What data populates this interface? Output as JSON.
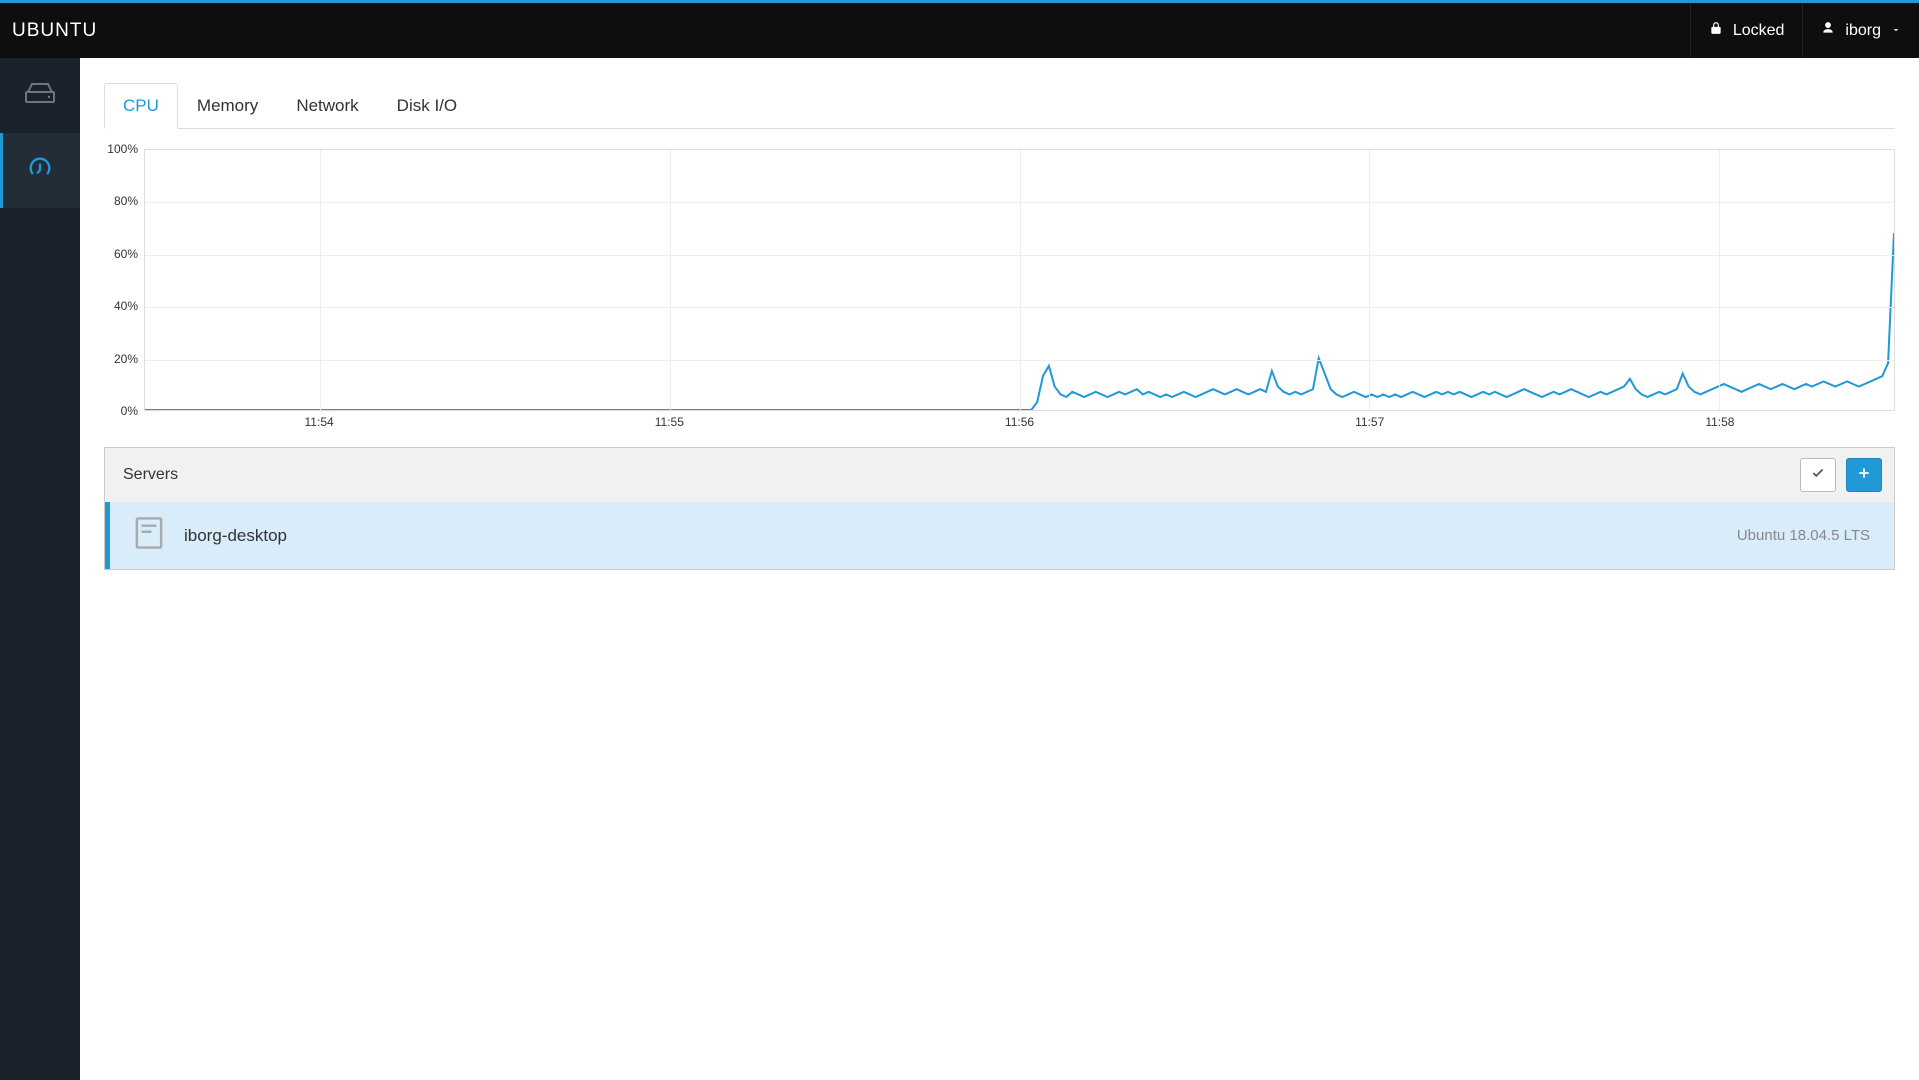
{
  "header": {
    "title": "UBUNTU",
    "lock_label": "Locked",
    "user_label": "iborg"
  },
  "tabs": [
    {
      "label": "CPU"
    },
    {
      "label": "Memory"
    },
    {
      "label": "Network"
    },
    {
      "label": "Disk I/O"
    }
  ],
  "servers": {
    "title": "Servers",
    "items": [
      {
        "name": "iborg-desktop",
        "os": "Ubuntu 18.04.5 LTS"
      }
    ]
  },
  "chart_data": {
    "type": "line",
    "title": "",
    "xlabel": "",
    "ylabel": "",
    "ylim": [
      0,
      100
    ],
    "y_ticks": [
      0,
      20,
      40,
      60,
      80,
      100
    ],
    "x_ticks": [
      "11:54",
      "11:55",
      "11:56",
      "11:57",
      "11:58"
    ],
    "x_range_points": 300,
    "series": [
      {
        "name": "cpu",
        "color": "#2099d6",
        "values": [
          0,
          0,
          0,
          0,
          0,
          0,
          0,
          0,
          0,
          0,
          0,
          0,
          0,
          0,
          0,
          0,
          0,
          0,
          0,
          0,
          0,
          0,
          0,
          0,
          0,
          0,
          0,
          0,
          0,
          0,
          0,
          0,
          0,
          0,
          0,
          0,
          0,
          0,
          0,
          0,
          0,
          0,
          0,
          0,
          0,
          0,
          0,
          0,
          0,
          0,
          0,
          0,
          0,
          0,
          0,
          0,
          0,
          0,
          0,
          0,
          0,
          0,
          0,
          0,
          0,
          0,
          0,
          0,
          0,
          0,
          0,
          0,
          0,
          0,
          0,
          0,
          0,
          0,
          0,
          0,
          0,
          0,
          0,
          0,
          0,
          0,
          0,
          0,
          0,
          0,
          0,
          0,
          0,
          0,
          0,
          0,
          0,
          0,
          0,
          0,
          0,
          0,
          0,
          0,
          0,
          0,
          0,
          0,
          0,
          0,
          0,
          0,
          0,
          0,
          0,
          0,
          0,
          0,
          0,
          0,
          0,
          0,
          0,
          0,
          0,
          0,
          0,
          0,
          0,
          0,
          0,
          0,
          0,
          0,
          0,
          0,
          0,
          0,
          0,
          0,
          0,
          0,
          0,
          0,
          0,
          0,
          0,
          0,
          0,
          0,
          0,
          0,
          3,
          13,
          17,
          9,
          6,
          5,
          7,
          6,
          5,
          6,
          7,
          6,
          5,
          6,
          7,
          6,
          7,
          8,
          6,
          7,
          6,
          5,
          6,
          5,
          6,
          7,
          6,
          5,
          6,
          7,
          8,
          7,
          6,
          7,
          8,
          7,
          6,
          7,
          8,
          7,
          15,
          9,
          7,
          6,
          7,
          6,
          7,
          8,
          20,
          14,
          8,
          6,
          5,
          6,
          7,
          6,
          5,
          6,
          5,
          6,
          5,
          6,
          5,
          6,
          7,
          6,
          5,
          6,
          7,
          6,
          7,
          6,
          7,
          6,
          5,
          6,
          7,
          6,
          7,
          6,
          5,
          6,
          7,
          8,
          7,
          6,
          5,
          6,
          7,
          6,
          7,
          8,
          7,
          6,
          5,
          6,
          7,
          6,
          7,
          8,
          9,
          12,
          8,
          6,
          5,
          6,
          7,
          6,
          7,
          8,
          14,
          9,
          7,
          6,
          7,
          8,
          9,
          10,
          9,
          8,
          7,
          8,
          9,
          10,
          9,
          8,
          9,
          10,
          9,
          8,
          9,
          10,
          9,
          10,
          11,
          10,
          9,
          10,
          11,
          10,
          9,
          10,
          11,
          12,
          13,
          18,
          68
        ]
      }
    ]
  }
}
